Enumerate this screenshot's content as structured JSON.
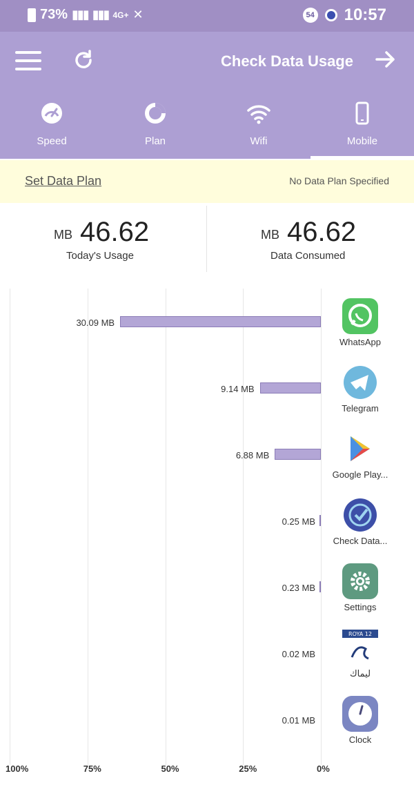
{
  "status_bar": {
    "battery_text": "73%",
    "network_text": "4G+",
    "time": "10:57",
    "notification_badge": "54"
  },
  "header": {
    "title": "Check Data Usage"
  },
  "tabs": [
    {
      "label": "Speed",
      "icon": "speedometer-icon"
    },
    {
      "label": "Plan",
      "icon": "donut-chart-icon"
    },
    {
      "label": "Wifi",
      "icon": "wifi-icon"
    },
    {
      "label": "Mobile",
      "icon": "phone-icon",
      "active": true
    }
  ],
  "plan_banner": {
    "set_plan_label": "Set Data Plan",
    "no_plan_text": "No Data Plan Specified"
  },
  "summary": {
    "today": {
      "value": "46.62",
      "unit": "MB",
      "caption": "Today's Usage"
    },
    "consumed": {
      "value": "46.62",
      "unit": "MB",
      "caption": "Data Consumed"
    }
  },
  "colors": {
    "accent": "#ad9fd3",
    "status_bar": "#a08fc4",
    "bar_fill": "#b3a6d6",
    "banner": "#fffddc"
  },
  "chart_data": {
    "type": "bar",
    "orientation": "horizontal",
    "axis_ticks": [
      "0%",
      "25%",
      "50%",
      "75%",
      "100%"
    ],
    "xlim": [
      0,
      100
    ],
    "categories": [
      "WhatsApp",
      "Telegram",
      "Google Play...",
      "Check Data...",
      "Settings",
      "ليماك",
      "Clock"
    ],
    "series": [
      {
        "values": [
          64.5,
          19.6,
          14.8,
          0.5,
          0.5,
          0.04,
          0.02
        ],
        "labels": [
          "30.09 MB",
          "9.14 MB",
          "6.88 MB",
          "0.25 MB",
          "0.23 MB",
          "0.02 MB",
          "0.01 MB"
        ]
      }
    ],
    "grid": true
  },
  "app_icon_names": [
    "whatsapp-icon",
    "telegram-icon",
    "google-play-icon",
    "check-data-icon",
    "settings-icon",
    "royal-app-icon",
    "clock-icon"
  ],
  "royal_badge_text": "ROYA 12"
}
